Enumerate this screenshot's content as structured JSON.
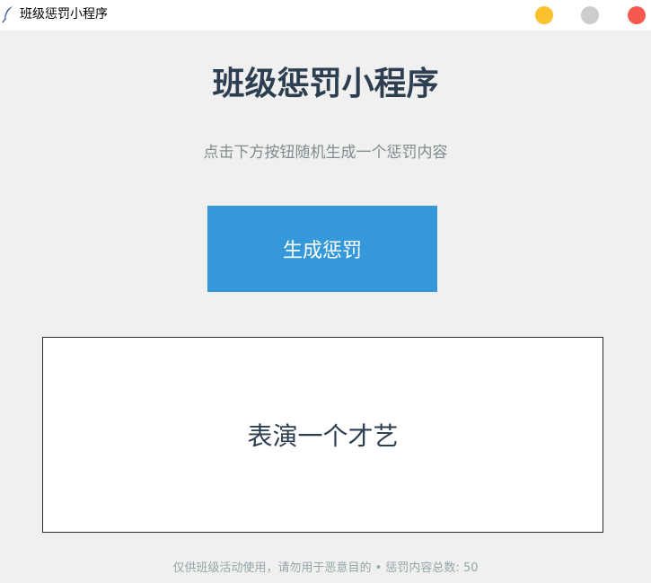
{
  "window": {
    "title": "班级惩罚小程序",
    "icon": "feather-icon",
    "buttons": {
      "minimize_color": "#f9c22e",
      "maximize_color": "#cccccc",
      "close_color": "#f5594e"
    }
  },
  "main": {
    "title": "班级惩罚小程序",
    "subtitle": "点击下方按钮随机生成一个惩罚内容",
    "generate_button": "生成惩罚",
    "result": "表演一个才艺"
  },
  "footer": {
    "text": "仅供班级活动使用，请勿用于恶意目的 • 惩罚内容总数: 50"
  },
  "colors": {
    "background": "#f0f0f0",
    "accent": "#3498db",
    "title": "#2c3e50",
    "muted": "#7f8c8d"
  }
}
